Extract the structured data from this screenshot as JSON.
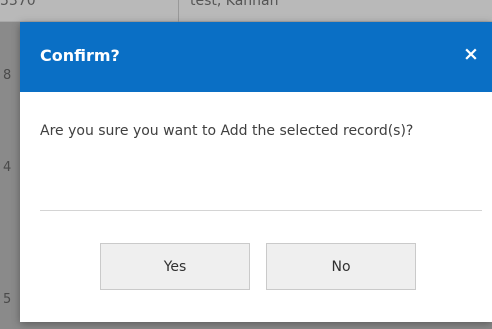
{
  "background": {
    "row": {
      "number_fragment": "5370",
      "name": "test, Kannan"
    },
    "side_fragments": [
      "8",
      "4",
      "5"
    ]
  },
  "dialog": {
    "title": "Confirm?",
    "close_label": "×",
    "message": "Are you sure you want to Add the selected record(s)?",
    "buttons": {
      "yes_label": "Yes",
      "no_label": "No"
    }
  },
  "colors": {
    "header_bg": "#0a6fc5",
    "header_text": "#ffffff",
    "button_bg": "#efefef",
    "overlay": "#8a8a8a"
  }
}
